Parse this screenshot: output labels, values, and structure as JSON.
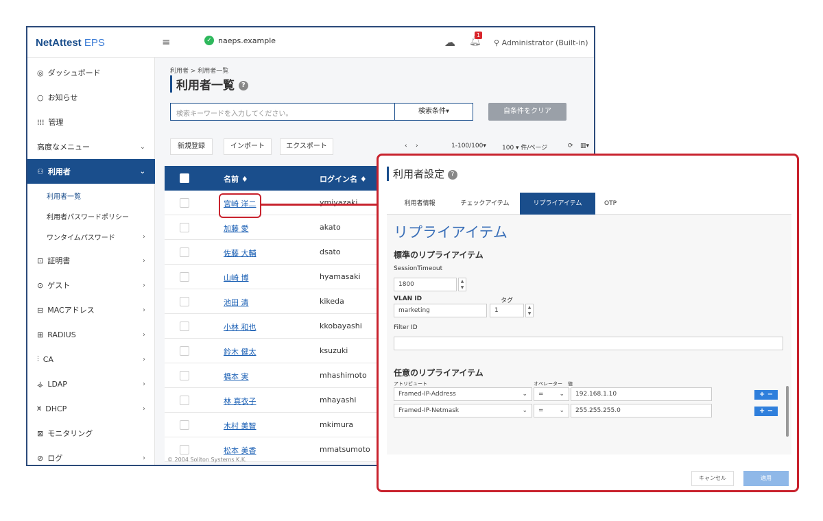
{
  "header": {
    "logo_a": "NetAttest",
    "logo_b": "EPS",
    "menu_icon": "≡",
    "host": "naeps.example",
    "cloud_icon": "☁",
    "bell_badge": "1",
    "user": "Administrator (Built-in)"
  },
  "sidebar": {
    "items": [
      {
        "icon": "◎",
        "label": "ダッシュボード",
        "chev": ""
      },
      {
        "icon": "○",
        "label": "お知らせ",
        "chev": ""
      },
      {
        "icon": "⁞⁞⁞",
        "label": "管理",
        "chev": ""
      },
      {
        "icon": "",
        "label": "高度なメニュー",
        "chev": "⌄"
      },
      {
        "icon": "⚇",
        "label": "利用者",
        "chev": "⌄"
      }
    ],
    "subitems": [
      {
        "label": "利用者一覧",
        "chev": ""
      },
      {
        "label": "利用者パスワードポリシー",
        "chev": ""
      },
      {
        "label": "ワンタイムパスワード",
        "chev": "›"
      }
    ],
    "items2": [
      {
        "icon": "⊡",
        "label": "証明書",
        "chev": "›"
      },
      {
        "icon": "⊙",
        "label": "ゲスト",
        "chev": "›"
      },
      {
        "icon": "⊟",
        "label": "MACアドレス",
        "chev": "›"
      },
      {
        "icon": "⊞",
        "label": "RADIUS",
        "chev": "›"
      },
      {
        "icon": "⫶",
        "label": "CA",
        "chev": "›"
      },
      {
        "icon": "⚶",
        "label": "LDAP",
        "chev": "›"
      },
      {
        "icon": "⩙",
        "label": "DHCP",
        "chev": "›"
      },
      {
        "icon": "⊠",
        "label": "モニタリング",
        "chev": ""
      },
      {
        "icon": "⊘",
        "label": "ログ",
        "chev": "›"
      }
    ]
  },
  "main": {
    "breadcrumb": "利用者 > 利用者一覧",
    "title": "利用者一覧",
    "help": "?",
    "search_placeholder": "検索キーワードを入力してください。",
    "search_cond": "検索条件▾",
    "clear": "自条件をクリア",
    "toolbar": {
      "new": "新規登録",
      "import": "インポート",
      "export": "エクスポート",
      "prev": "‹",
      "next": "›",
      "range": "1-100/100▾",
      "perpage": "100 ▾ 件/ページ",
      "refresh": "⟳",
      "cols": "▥▾"
    },
    "table": {
      "col_name": "名前 ♦",
      "col_login": "ログイン名 ♦",
      "rows": [
        {
          "name": "宮崎 洋二",
          "login": "ymiyazaki"
        },
        {
          "name": "加藤 愛",
          "login": "akato"
        },
        {
          "name": "佐藤 大輔",
          "login": "dsato"
        },
        {
          "name": "山崎 博",
          "login": "hyamasaki"
        },
        {
          "name": "池田 清",
          "login": "kikeda"
        },
        {
          "name": "小林 和也",
          "login": "kkobayashi"
        },
        {
          "name": "鈴木 健太",
          "login": "ksuzuki"
        },
        {
          "name": "橋本 実",
          "login": "mhashimoto"
        },
        {
          "name": "林 真衣子",
          "login": "mhayashi"
        },
        {
          "name": "木村 美智",
          "login": "mkimura"
        },
        {
          "name": "松本 美香",
          "login": "mmatsumoto"
        }
      ]
    },
    "footer": "© 2004 Soliton Systems K.K."
  },
  "dialog": {
    "title": "利用者設定",
    "help": "?",
    "tabs": [
      "利用者情報",
      "チェックアイテム",
      "リプライアイテム",
      "OTP"
    ],
    "heading": "リプライアイテム",
    "std_title": "標準のリプライアイテム",
    "session_label": "SessionTimeout",
    "session_value": "1800",
    "vlan_label": "VLAN ID",
    "vlan_value": "marketing",
    "tag_label": "タグ",
    "tag_value": "1",
    "filter_label": "Filter ID",
    "filter_value": "",
    "opt_title": "任意のリプライアイテム",
    "col_attr": "アトリビュート",
    "col_op": "オペレーター",
    "col_val": "値",
    "items": [
      {
        "attr": "Framed-IP-Address",
        "op": "=",
        "value": "192.168.1.10"
      },
      {
        "attr": "Framed-IP-Netmask",
        "op": "=",
        "value": "255.255.255.0"
      }
    ],
    "pm": "+ −",
    "cancel": "キャンセル",
    "apply": "適用"
  }
}
